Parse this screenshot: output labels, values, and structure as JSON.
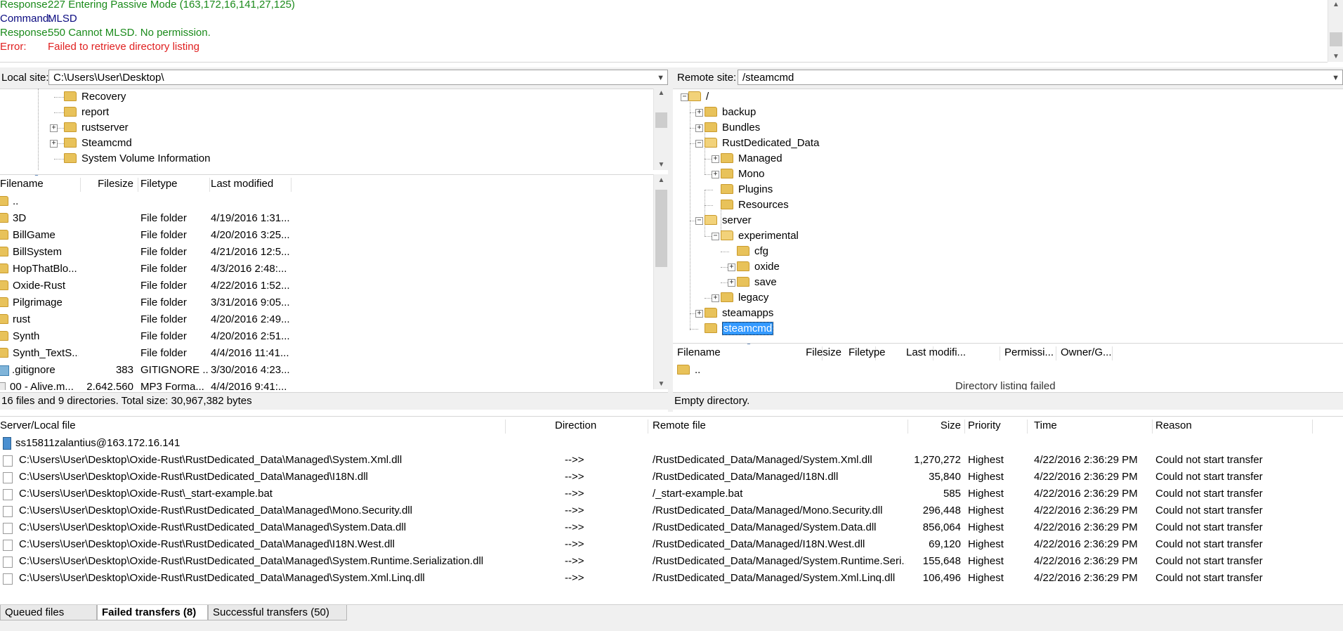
{
  "message_log": [
    {
      "label": "Response:",
      "text": "227 Entering Passive Mode (163,172,16,141,27,125)",
      "color": "green"
    },
    {
      "label": "Command:",
      "text": "MLSD",
      "color": "blue"
    },
    {
      "label": "Response:",
      "text": "550 Cannot MLSD. No permission.",
      "color": "green"
    },
    {
      "label": "Error:",
      "text": "Failed to retrieve directory listing",
      "color": "red"
    }
  ],
  "local": {
    "site_label": "Local site:",
    "path": "C:\\Users\\User\\Desktop\\",
    "tree": [
      {
        "name": "Recovery",
        "expander": false
      },
      {
        "name": "report",
        "expander": false
      },
      {
        "name": "rustserver",
        "expander": true
      },
      {
        "name": "Steamcmd",
        "expander": true
      },
      {
        "name": "System Volume Information",
        "expander": false
      }
    ],
    "columns": [
      "Filename",
      "Filesize",
      "Filetype",
      "Last modified"
    ],
    "files": [
      {
        "name": "..",
        "size": "",
        "type": "",
        "modified": "",
        "icon": "folder"
      },
      {
        "name": "3D",
        "size": "",
        "type": "File folder",
        "modified": "4/19/2016 1:31...",
        "icon": "folder"
      },
      {
        "name": "BillGame",
        "size": "",
        "type": "File folder",
        "modified": "4/20/2016 3:25...",
        "icon": "folder"
      },
      {
        "name": "BillSystem",
        "size": "",
        "type": "File folder",
        "modified": "4/21/2016 12:5...",
        "icon": "folder"
      },
      {
        "name": "HopThatBlo...",
        "size": "",
        "type": "File folder",
        "modified": "4/3/2016 2:48:...",
        "icon": "folder"
      },
      {
        "name": "Oxide-Rust",
        "size": "",
        "type": "File folder",
        "modified": "4/22/2016 1:52...",
        "icon": "folder"
      },
      {
        "name": "Pilgrimage",
        "size": "",
        "type": "File folder",
        "modified": "3/31/2016 9:05...",
        "icon": "folder"
      },
      {
        "name": "rust",
        "size": "",
        "type": "File folder",
        "modified": "4/20/2016 2:49...",
        "icon": "folder"
      },
      {
        "name": "Synth",
        "size": "",
        "type": "File folder",
        "modified": "4/20/2016 2:51...",
        "icon": "folder"
      },
      {
        "name": "Synth_TextS...",
        "size": "",
        "type": "File folder",
        "modified": "4/4/2016 11:41...",
        "icon": "folder"
      },
      {
        "name": ".gitignore",
        "size": "383",
        "type": "GITIGNORE ...",
        "modified": "3/30/2016 4:23...",
        "icon": "gitignore"
      },
      {
        "name": "00 - Alive.m...",
        "size": "2,642,560",
        "type": "MP3 Forma...",
        "modified": "4/4/2016 9:41:...",
        "icon": "mp3"
      }
    ],
    "status": "16 files and 9 directories. Total size: 30,967,382 bytes"
  },
  "remote": {
    "site_label": "Remote site:",
    "path": "/steamcmd",
    "tree": [
      {
        "name": "/",
        "expander": "-",
        "level": 0
      },
      {
        "name": "backup",
        "expander": "+",
        "level": 1
      },
      {
        "name": "Bundles",
        "expander": "+",
        "level": 1
      },
      {
        "name": "RustDedicated_Data",
        "expander": "-",
        "level": 1
      },
      {
        "name": "Managed",
        "expander": "+",
        "level": 2
      },
      {
        "name": "Mono",
        "expander": "+",
        "level": 2
      },
      {
        "name": "Plugins",
        "expander": "",
        "level": 2
      },
      {
        "name": "Resources",
        "expander": "",
        "level": 2
      },
      {
        "name": "server",
        "expander": "-",
        "level": 1
      },
      {
        "name": "experimental",
        "expander": "-",
        "level": 2
      },
      {
        "name": "cfg",
        "expander": "",
        "level": 3
      },
      {
        "name": "oxide",
        "expander": "+",
        "level": 3
      },
      {
        "name": "save",
        "expander": "+",
        "level": 3
      },
      {
        "name": "legacy",
        "expander": "+",
        "level": 2
      },
      {
        "name": "steamapps",
        "expander": "+",
        "level": 1
      },
      {
        "name": "steamcmd",
        "expander": "",
        "level": 1,
        "selected": true
      }
    ],
    "columns": [
      "Filename",
      "Filesize",
      "Filetype",
      "Last modifi...",
      "Permissi...",
      "Owner/G..."
    ],
    "files": [
      {
        "name": ".."
      }
    ],
    "overlay_text": "Directory listing failed",
    "status": "Empty directory."
  },
  "queue": {
    "columns": [
      "Server/Local file",
      "Direction",
      "Remote file",
      "Size",
      "Priority",
      "Time",
      "Reason"
    ],
    "server": "ss15811zalantius@163.172.16.141",
    "items": [
      {
        "local": "C:\\Users\\User\\Desktop\\Oxide-Rust\\RustDedicated_Data\\Managed\\System.Xml.dll",
        "dir": "-->>",
        "remote": "/RustDedicated_Data/Managed/System.Xml.dll",
        "size": "1,270,272",
        "priority": "Highest",
        "time": "4/22/2016 2:36:29 PM",
        "reason": "Could not start transfer"
      },
      {
        "local": "C:\\Users\\User\\Desktop\\Oxide-Rust\\RustDedicated_Data\\Managed\\I18N.dll",
        "dir": "-->>",
        "remote": "/RustDedicated_Data/Managed/I18N.dll",
        "size": "35,840",
        "priority": "Highest",
        "time": "4/22/2016 2:36:29 PM",
        "reason": "Could not start transfer"
      },
      {
        "local": "C:\\Users\\User\\Desktop\\Oxide-Rust\\_start-example.bat",
        "dir": "-->>",
        "remote": "/_start-example.bat",
        "size": "585",
        "priority": "Highest",
        "time": "4/22/2016 2:36:29 PM",
        "reason": "Could not start transfer"
      },
      {
        "local": "C:\\Users\\User\\Desktop\\Oxide-Rust\\RustDedicated_Data\\Managed\\Mono.Security.dll",
        "dir": "-->>",
        "remote": "/RustDedicated_Data/Managed/Mono.Security.dll",
        "size": "296,448",
        "priority": "Highest",
        "time": "4/22/2016 2:36:29 PM",
        "reason": "Could not start transfer"
      },
      {
        "local": "C:\\Users\\User\\Desktop\\Oxide-Rust\\RustDedicated_Data\\Managed\\System.Data.dll",
        "dir": "-->>",
        "remote": "/RustDedicated_Data/Managed/System.Data.dll",
        "size": "856,064",
        "priority": "Highest",
        "time": "4/22/2016 2:36:29 PM",
        "reason": "Could not start transfer"
      },
      {
        "local": "C:\\Users\\User\\Desktop\\Oxide-Rust\\RustDedicated_Data\\Managed\\I18N.West.dll",
        "dir": "-->>",
        "remote": "/RustDedicated_Data/Managed/I18N.West.dll",
        "size": "69,120",
        "priority": "Highest",
        "time": "4/22/2016 2:36:29 PM",
        "reason": "Could not start transfer"
      },
      {
        "local": "C:\\Users\\User\\Desktop\\Oxide-Rust\\RustDedicated_Data\\Managed\\System.Runtime.Serialization.dll",
        "dir": "-->>",
        "remote": "/RustDedicated_Data/Managed/System.Runtime.Seri...",
        "size": "155,648",
        "priority": "Highest",
        "time": "4/22/2016 2:36:29 PM",
        "reason": "Could not start transfer"
      },
      {
        "local": "C:\\Users\\User\\Desktop\\Oxide-Rust\\RustDedicated_Data\\Managed\\System.Xml.Linq.dll",
        "dir": "-->>",
        "remote": "/RustDedicated_Data/Managed/System.Xml.Linq.dll",
        "size": "106,496",
        "priority": "Highest",
        "time": "4/22/2016 2:36:29 PM",
        "reason": "Could not start transfer"
      }
    ]
  },
  "tabs": [
    {
      "label": "Queued files",
      "active": false
    },
    {
      "label": "Failed transfers (8)",
      "active": true
    },
    {
      "label": "Successful transfers (50)",
      "active": false
    }
  ]
}
